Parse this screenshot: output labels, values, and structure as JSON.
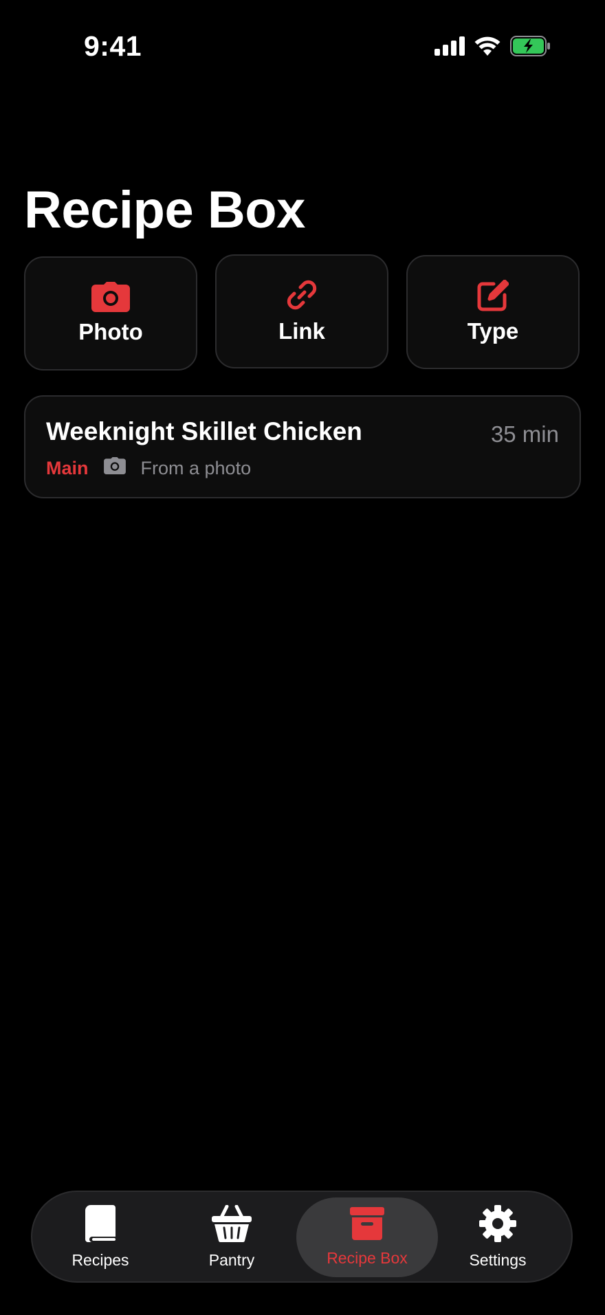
{
  "status": {
    "time": "9:41",
    "battery_color": "#34c759"
  },
  "page": {
    "title": "Recipe Box"
  },
  "actions": [
    {
      "label": "Photo",
      "icon": "camera-icon"
    },
    {
      "label": "Link",
      "icon": "link-icon"
    },
    {
      "label": "Type",
      "icon": "compose-icon"
    }
  ],
  "recipes": [
    {
      "name": "Weeknight Skillet Chicken",
      "time": "35 min",
      "category": "Main",
      "source": "From a photo",
      "source_icon": "camera-icon"
    }
  ],
  "tabs": [
    {
      "label": "Recipes",
      "icon": "book-icon",
      "active": false
    },
    {
      "label": "Pantry",
      "icon": "basket-icon",
      "active": false
    },
    {
      "label": "Recipe Box",
      "icon": "archive-box-icon",
      "active": true
    },
    {
      "label": "Settings",
      "icon": "gear-icon",
      "active": false
    }
  ],
  "colors": {
    "accent": "#e5383b",
    "background": "#000000",
    "card": "#0d0d0d",
    "secondary_text": "#8e8e93"
  }
}
